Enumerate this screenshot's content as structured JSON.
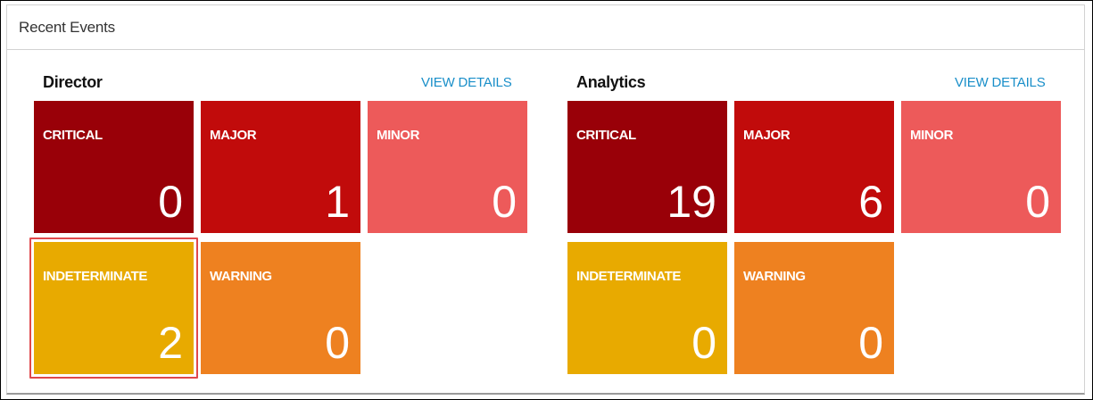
{
  "panel": {
    "title": "Recent Events"
  },
  "sections": [
    {
      "title": "Director",
      "view_details": "VIEW DETAILS",
      "tiles": [
        {
          "label": "CRITICAL",
          "count": "0",
          "color": "#990008"
        },
        {
          "label": "MAJOR",
          "count": "1",
          "color": "#c10b0b"
        },
        {
          "label": "MINOR",
          "count": "0",
          "color": "#ed5a5a"
        },
        {
          "label": "INDETERMINATE",
          "count": "2",
          "color": "#e8aa00",
          "selected": true
        },
        {
          "label": "WARNING",
          "count": "0",
          "color": "#ee8120"
        }
      ]
    },
    {
      "title": "Analytics",
      "view_details": "VIEW DETAILS",
      "tiles": [
        {
          "label": "CRITICAL",
          "count": "19",
          "color": "#990008"
        },
        {
          "label": "MAJOR",
          "count": "6",
          "color": "#c10b0b"
        },
        {
          "label": "MINOR",
          "count": "0",
          "color": "#ed5a5a"
        },
        {
          "label": "INDETERMINATE",
          "count": "0",
          "color": "#e8aa00"
        },
        {
          "label": "WARNING",
          "count": "0",
          "color": "#ee8120"
        }
      ]
    }
  ],
  "colors": {
    "link": "#1a8fc9",
    "selection_ring": "#e0484a"
  }
}
